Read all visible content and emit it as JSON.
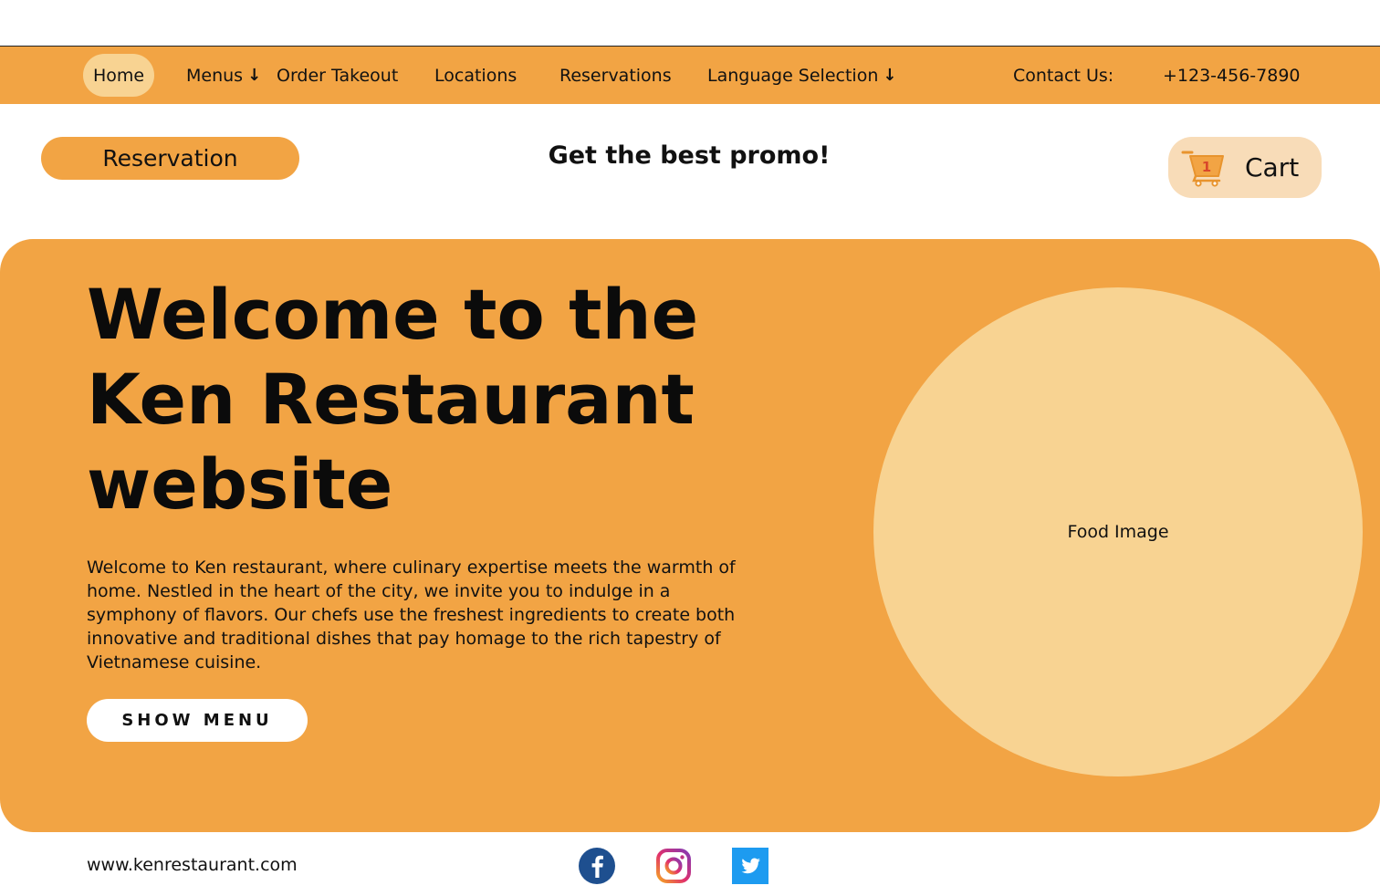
{
  "nav": {
    "items": [
      {
        "label": "Home",
        "active": true
      },
      {
        "label": "Menus",
        "arrow": "↓"
      },
      {
        "label": "Order Takeout"
      },
      {
        "label": "Locations"
      },
      {
        "label": "Reservations"
      },
      {
        "label": "Language Selection",
        "arrow": "↓"
      }
    ],
    "contact_label": "Contact Us:",
    "contact_phone": "+123-456-7890"
  },
  "header": {
    "reservation_label": "Reservation",
    "promo": "Get the best promo!",
    "cart_label": "Cart",
    "cart_count": "1",
    "cart_icon": "shopping-cart-icon"
  },
  "hero": {
    "title": "Welcome to the Ken Restaurant website",
    "description": "Welcome to Ken restaurant, where culinary expertise meets the warmth of home. Nestled in the heart of the city, we invite you to indulge in a symphony of flavors. Our chefs use the freshest ingredients to create both innovative and traditional dishes that pay homage to the rich tapestry of Vietnamese cuisine.",
    "cta_label": "SHOW MENU",
    "image_placeholder": "Food Image"
  },
  "footer": {
    "url": "www.kenrestaurant.com",
    "social": [
      "facebook-icon",
      "instagram-icon",
      "twitter-icon"
    ]
  },
  "colors": {
    "accent": "#f2a444",
    "accent_light": "#f8d392",
    "cart_bg": "#f8dcb8"
  }
}
